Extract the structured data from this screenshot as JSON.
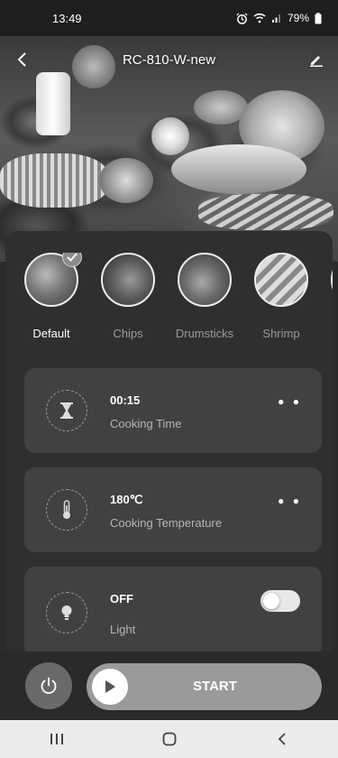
{
  "status_bar": {
    "time": "13:49",
    "battery": "79%"
  },
  "header": {
    "title": "RC-810-W-new"
  },
  "modes": [
    {
      "label": "Default",
      "selected": true
    },
    {
      "label": "Chips",
      "selected": false
    },
    {
      "label": "Drumsticks",
      "selected": false
    },
    {
      "label": "Shrimp",
      "selected": false
    }
  ],
  "settings": {
    "time": {
      "value": "00:15",
      "label": "Cooking Time"
    },
    "temperature": {
      "value": "180℃",
      "label": "Cooking Temperature"
    },
    "light": {
      "value": "OFF",
      "label": "Light",
      "on": false
    }
  },
  "controls": {
    "start_label": "START"
  },
  "colors": {
    "panel": "#2f2f2f",
    "card": "#414141",
    "start_button": "#9a9a9a",
    "power_button": "#6a6a6a"
  },
  "icons": [
    "back-arrow-icon",
    "edit-pencil-icon",
    "hourglass-icon",
    "thermometer-icon",
    "light-bulb-icon",
    "power-icon",
    "play-icon",
    "check-icon"
  ]
}
